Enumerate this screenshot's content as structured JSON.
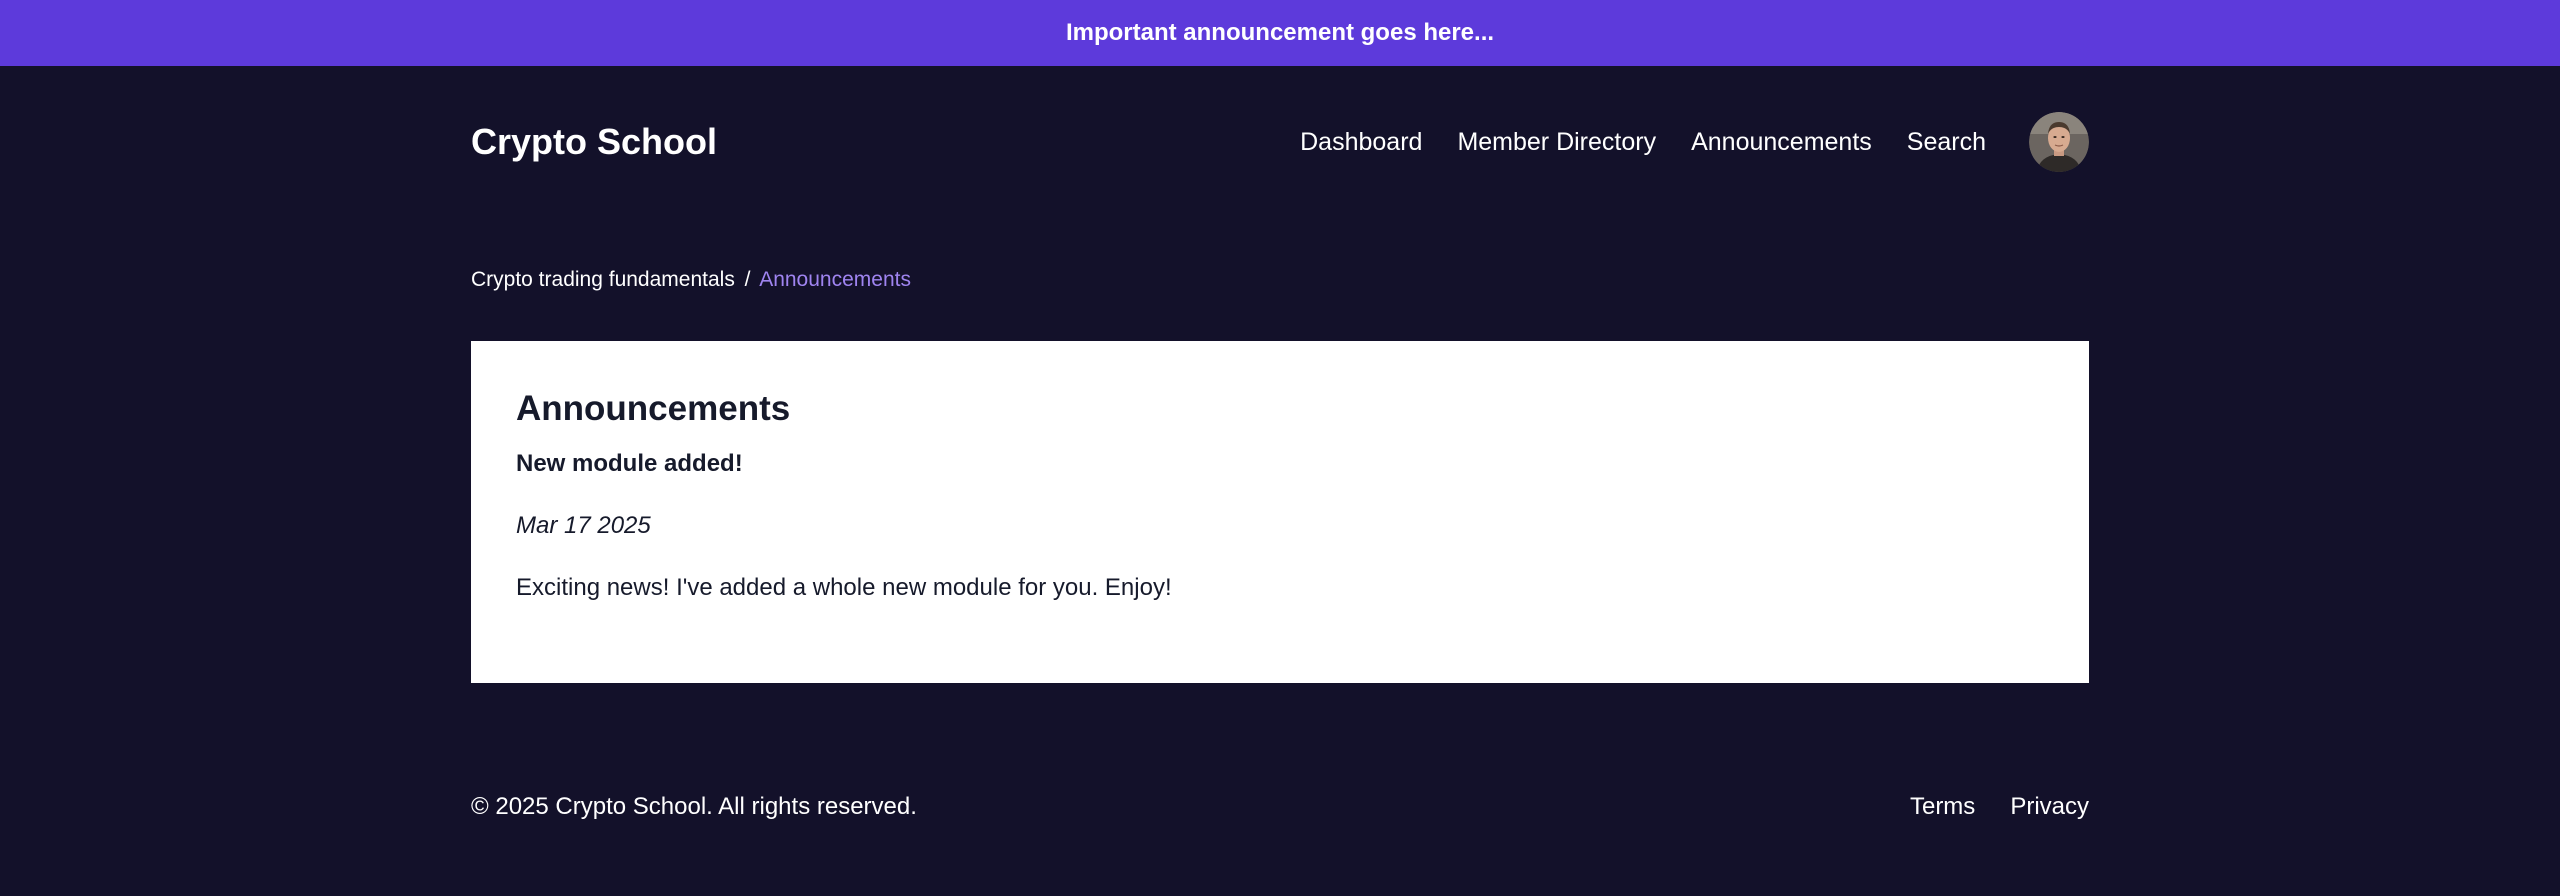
{
  "announcement_bar": {
    "text": "Important announcement goes here..."
  },
  "header": {
    "logo": "Crypto School",
    "nav": [
      {
        "label": "Dashboard"
      },
      {
        "label": "Member Directory"
      },
      {
        "label": "Announcements"
      },
      {
        "label": "Search"
      }
    ],
    "avatar_icon": "user-avatar"
  },
  "breadcrumb": {
    "parent": "Crypto trading fundamentals",
    "separator": "/",
    "current": "Announcements"
  },
  "main": {
    "heading": "Announcements",
    "posts": [
      {
        "title": "New module added!",
        "date": "Mar 17 2025",
        "body": "Exciting news! I've added a whole new module for you. Enjoy!"
      }
    ]
  },
  "footer": {
    "copyright": "© 2025 Crypto School. All rights reserved.",
    "links": [
      {
        "label": "Terms"
      },
      {
        "label": "Privacy"
      }
    ]
  },
  "colors": {
    "announcement_bg": "#5d3adb",
    "page_bg": "#13112a",
    "accent": "#9f84f0",
    "card_bg": "#ffffff"
  }
}
